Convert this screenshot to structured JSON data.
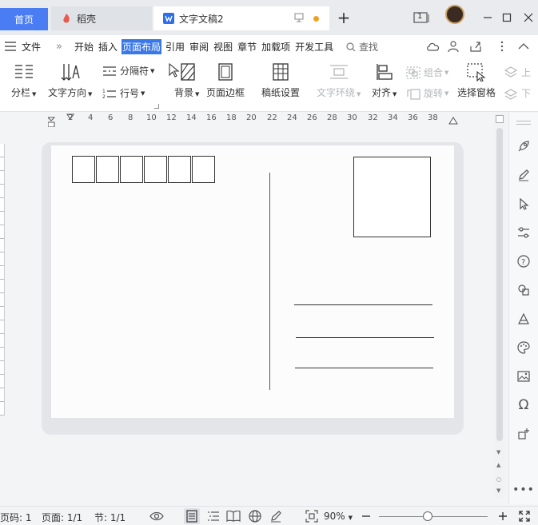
{
  "titlebar": {
    "home_tab": "首页",
    "tabs": [
      {
        "label": "稻壳"
      },
      {
        "label": "文字文稿2"
      }
    ],
    "page_count_badge": "1"
  },
  "menubar": {
    "file": "文件",
    "items": [
      "开始",
      "插入",
      "页面布局",
      "引用",
      "审阅",
      "视图",
      "章节",
      "加载项",
      "开发工具"
    ],
    "active": "页面布局",
    "search": "查找"
  },
  "ribbon": {
    "columns": "分栏",
    "text_direction": "文字方向",
    "separator": "分隔符",
    "line_number": "行号",
    "background": "背景",
    "page_border": "页面边框",
    "manuscript": "稿纸设置",
    "text_wrap": "文字环绕",
    "align": "对齐",
    "group": "组合",
    "rotate": "旋转",
    "selection_pane": "选择窗格",
    "up": "上",
    "down": "下"
  },
  "ruler": {
    "ticks": [
      "2",
      "4",
      "6",
      "8",
      "10",
      "12",
      "14",
      "16",
      "18",
      "20",
      "22",
      "24",
      "26",
      "28",
      "30",
      "32",
      "34",
      "36",
      "38"
    ]
  },
  "statusbar": {
    "page_no": "页码: 1",
    "page": "页面: 1/1",
    "section": "节: 1/1",
    "zoom": "90%"
  },
  "colors": {
    "accent": "#3b78e7",
    "home_tab": "#4a7df4",
    "unsaved_dot": "#f0a020"
  }
}
